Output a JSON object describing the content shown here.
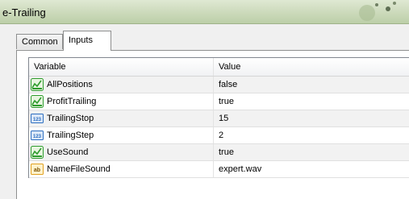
{
  "window": {
    "title": "e-Trailing"
  },
  "tabs": [
    {
      "label": "Common",
      "active": false
    },
    {
      "label": "Inputs",
      "active": true
    }
  ],
  "table": {
    "headers": {
      "variable": "Variable",
      "value": "Value"
    },
    "rows": [
      {
        "icon": "bool-icon",
        "name": "AllPositions",
        "value": "false"
      },
      {
        "icon": "bool-icon",
        "name": "ProfitTrailing",
        "value": "true"
      },
      {
        "icon": "int-icon",
        "name": "TrailingStop",
        "value": "15"
      },
      {
        "icon": "int-icon",
        "name": "TrailingStep",
        "value": "2"
      },
      {
        "icon": "bool-icon",
        "name": "UseSound",
        "value": "true"
      },
      {
        "icon": "string-icon",
        "name": "NameFileSound",
        "value": "expert.wav"
      }
    ]
  },
  "colors": {
    "titlebar": "#cfdcbf",
    "bool_icon": "#2e9c2e",
    "int_icon": "#2f6fc0",
    "string_icon": "#e0a020"
  }
}
